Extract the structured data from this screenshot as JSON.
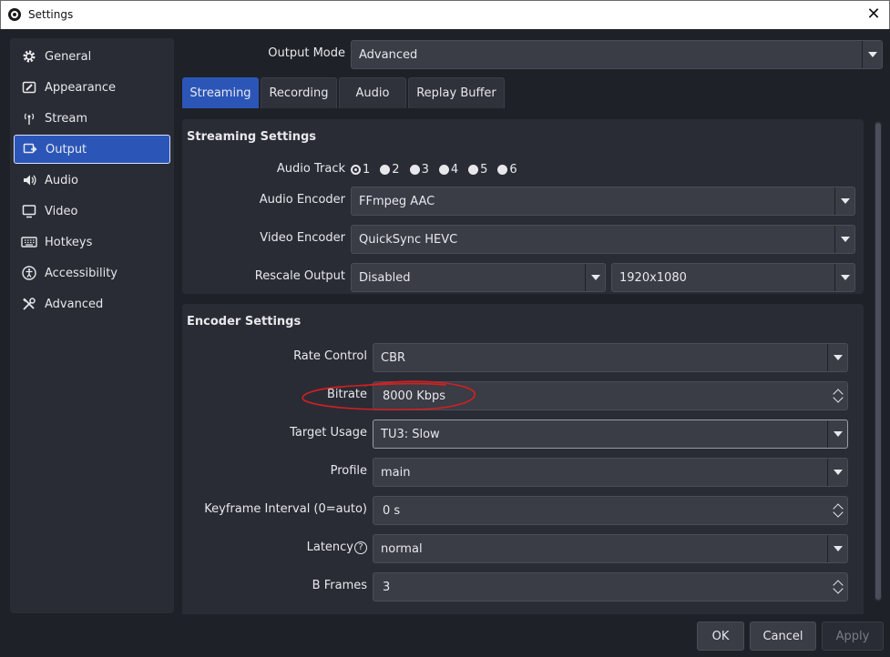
{
  "window": {
    "title": "Settings",
    "close_label": "✕"
  },
  "sidebar": {
    "items": [
      {
        "label": "General",
        "icon": "gear-icon"
      },
      {
        "label": "Appearance",
        "icon": "appearance-icon"
      },
      {
        "label": "Stream",
        "icon": "antenna-icon"
      },
      {
        "label": "Output",
        "icon": "output-icon",
        "active": true
      },
      {
        "label": "Audio",
        "icon": "speaker-icon"
      },
      {
        "label": "Video",
        "icon": "monitor-icon"
      },
      {
        "label": "Hotkeys",
        "icon": "keyboard-icon"
      },
      {
        "label": "Accessibility",
        "icon": "accessibility-icon"
      },
      {
        "label": "Advanced",
        "icon": "tools-icon"
      }
    ]
  },
  "output_mode": {
    "label": "Output Mode",
    "value": "Advanced"
  },
  "tabs": [
    {
      "label": "Streaming",
      "active": true
    },
    {
      "label": "Recording"
    },
    {
      "label": "Audio"
    },
    {
      "label": "Replay Buffer"
    }
  ],
  "streaming": {
    "title": "Streaming Settings",
    "audio_track_label": "Audio Track",
    "audio_tracks": [
      {
        "label": "1",
        "checked": true
      },
      {
        "label": "2"
      },
      {
        "label": "3"
      },
      {
        "label": "4"
      },
      {
        "label": "5"
      },
      {
        "label": "6"
      }
    ],
    "audio_encoder_label": "Audio Encoder",
    "audio_encoder_value": "FFmpeg AAC",
    "video_encoder_label": "Video Encoder",
    "video_encoder_value": "QuickSync HEVC",
    "rescale_label": "Rescale Output",
    "rescale_value": "Disabled",
    "rescale_resolution": "1920x1080"
  },
  "encoder": {
    "title": "Encoder Settings",
    "rate_control_label": "Rate Control",
    "rate_control_value": "CBR",
    "bitrate_label": "Bitrate",
    "bitrate_value": "8000 Kbps",
    "target_usage_label": "Target Usage",
    "target_usage_value": "TU3: Slow",
    "profile_label": "Profile",
    "profile_value": "main",
    "keyframe_label": "Keyframe Interval (0=auto)",
    "keyframe_value": "0 s",
    "latency_label": "Latency",
    "latency_value": "normal",
    "bframes_label": "B Frames",
    "bframes_value": "3"
  },
  "footer": {
    "ok": "OK",
    "cancel": "Cancel",
    "apply": "Apply"
  },
  "colors": {
    "accent": "#2b56b8",
    "annotation": "#d42020",
    "background": "#1f2128"
  }
}
